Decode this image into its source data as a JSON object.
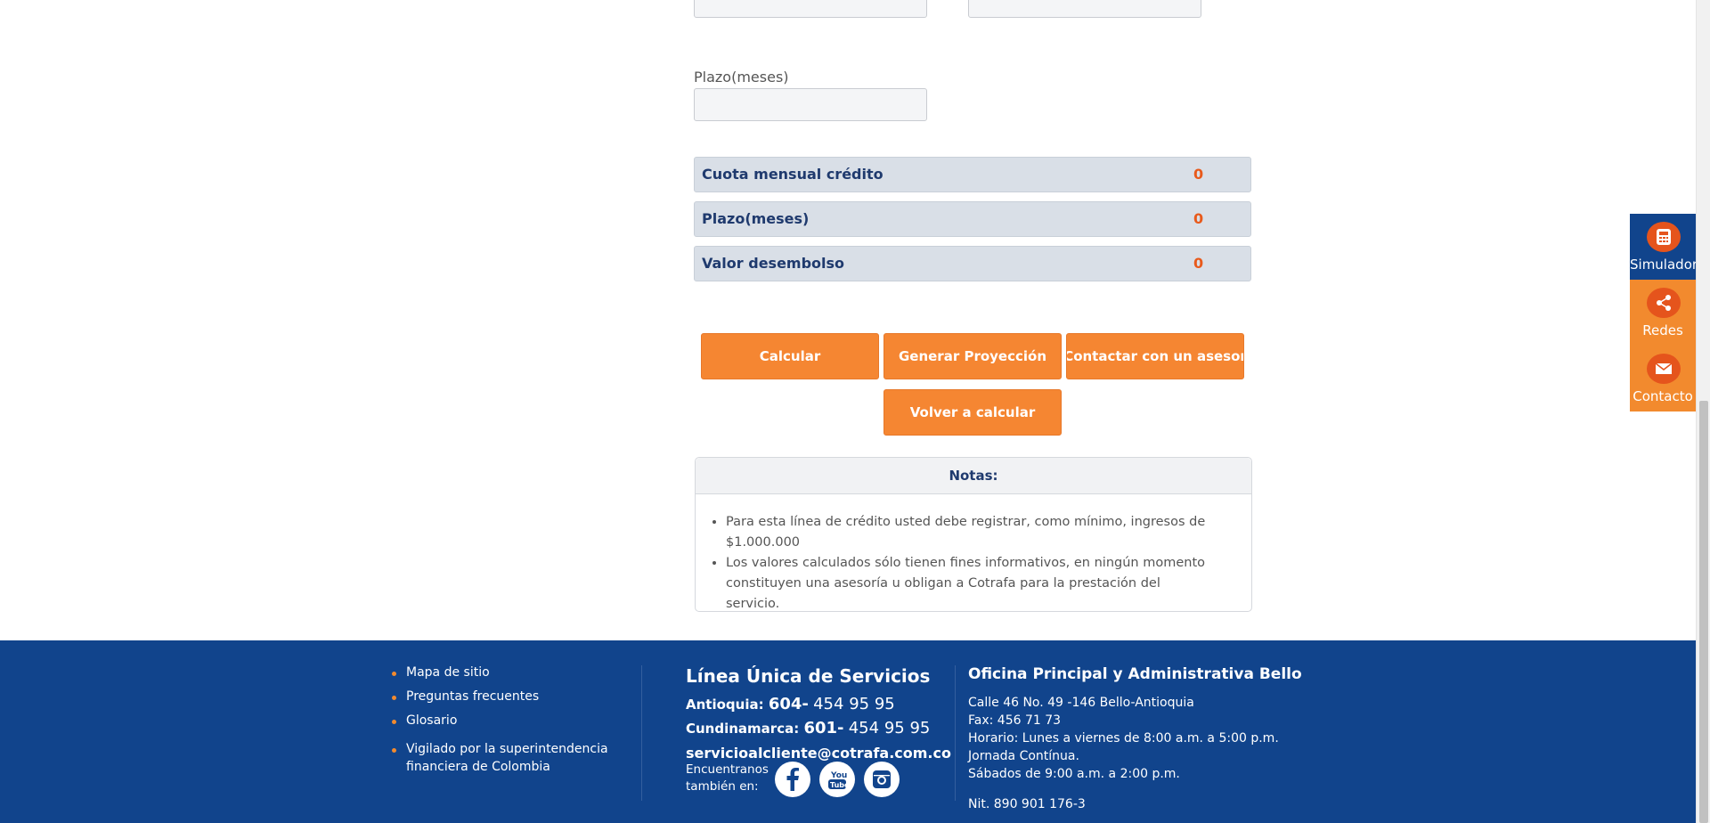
{
  "form": {
    "plazo_label": "Plazo(meses)",
    "plazo_value": ""
  },
  "results": [
    {
      "label": "Cuota mensual crédito",
      "value": "0"
    },
    {
      "label": "Plazo(meses)",
      "value": "0"
    },
    {
      "label": "Valor desembolso",
      "value": "0"
    }
  ],
  "buttons": {
    "calcular": "Calcular",
    "proyeccion": "Generar Proyección",
    "contactar": "Contactar con un asesor",
    "volver": "Volver a calcular"
  },
  "notes": {
    "title": "Notas:",
    "items": [
      "Para esta línea de crédito usted debe registrar, como mínimo, ingresos de $1.000.000",
      "Los valores calculados sólo tienen fines informativos, en ningún momento constituyen una asesoría u obligan a Cotrafa para la prestación del servicio."
    ]
  },
  "side_panel": {
    "items": [
      {
        "label": "Simulador",
        "icon": "calculator-icon",
        "active": true
      },
      {
        "label": "Redes",
        "icon": "share-icon",
        "active": false
      },
      {
        "label": "Contacto",
        "icon": "mail-icon",
        "active": false
      }
    ]
  },
  "footer": {
    "links": [
      "Mapa de sitio",
      "Preguntas frecuentes",
      "Glosario",
      "Vigilado por la superintendencia",
      "financiera de Colombia"
    ],
    "line_title": "Línea Única de Servicios",
    "antioquia_label": "Antioquia:",
    "antioquia_code": "604-",
    "antioquia_number": "454 95 95",
    "cundinamarca_label": "Cundinamarca:",
    "cundinamarca_code": "601-",
    "cundinamarca_number": "454 95 95",
    "email": "servicioalcliente@cotrafa.com.co",
    "social_text_1": "Encuentranos",
    "social_text_2": "también en:",
    "social_icons": [
      "facebook-icon",
      "youtube-icon",
      "instagram-icon"
    ],
    "office_title": "Oficina Principal y Administrativa Bello",
    "address": "Calle 46 No. 49 -146 Bello-Antioquia",
    "fax": "Fax: 456 71 73",
    "hours_1": "Horario: Lunes a viernes de 8:00 a.m. a 5:00 p.m.",
    "hours_2": "Jornada Contínua.",
    "hours_3": "Sábados de 9:00 a.m. a 2:00 p.m.",
    "nit": "Nit. 890 901 176-3"
  },
  "colors": {
    "accent": "#f58632",
    "navy": "#11448c",
    "result_value": "#e85a1c"
  }
}
